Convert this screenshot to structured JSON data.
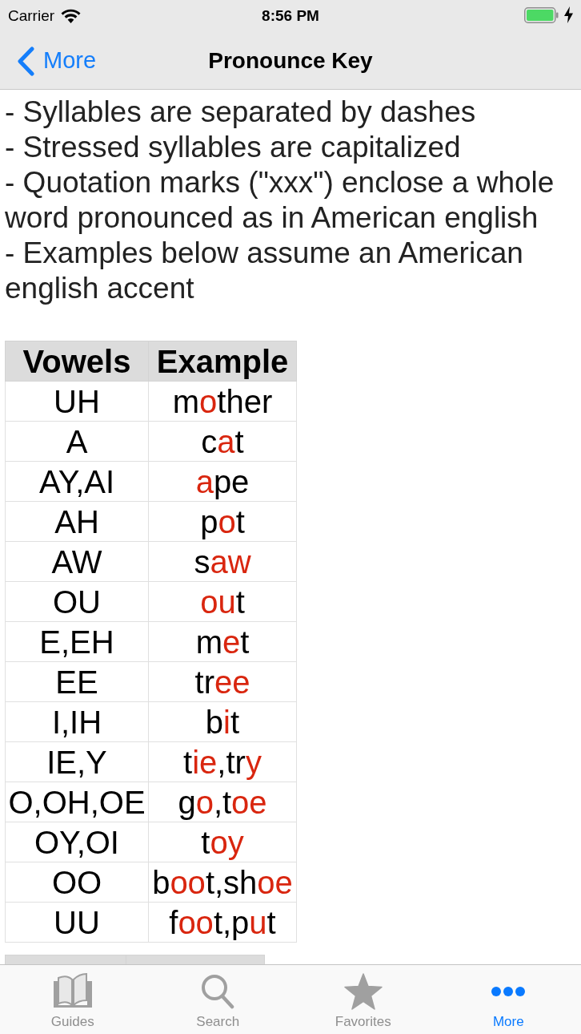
{
  "status_bar": {
    "carrier": "Carrier",
    "time": "8:56 PM"
  },
  "nav_bar": {
    "back": "More",
    "title": "Pronounce Key"
  },
  "notes": [
    "- Syllables are separated by dashes",
    "- Stressed syllables are capitalized",
    "- Quotation marks (\"xxx\") enclose a whole word pronounced as in American english",
    "- Examples below assume an American english accent"
  ],
  "vowel_table": {
    "columns": [
      "Vowels",
      "Example"
    ],
    "rows": [
      {
        "vowels": "UH",
        "example": [
          {
            "text": "m",
            "highlighted": false
          },
          {
            "text": "o",
            "highlighted": true
          },
          {
            "text": "ther",
            "highlighted": false
          }
        ]
      },
      {
        "vowels": "A",
        "example": [
          {
            "text": "c",
            "highlighted": false
          },
          {
            "text": "a",
            "highlighted": true
          },
          {
            "text": "t",
            "highlighted": false
          }
        ]
      },
      {
        "vowels": "AY,AI",
        "example": [
          {
            "text": "a",
            "highlighted": true
          },
          {
            "text": "pe",
            "highlighted": false
          }
        ]
      },
      {
        "vowels": "AH",
        "example": [
          {
            "text": "p",
            "highlighted": false
          },
          {
            "text": "o",
            "highlighted": true
          },
          {
            "text": "t",
            "highlighted": false
          }
        ]
      },
      {
        "vowels": "AW",
        "example": [
          {
            "text": "s",
            "highlighted": false
          },
          {
            "text": "aw",
            "highlighted": true
          }
        ]
      },
      {
        "vowels": "OU",
        "example": [
          {
            "text": "ou",
            "highlighted": true
          },
          {
            "text": "t",
            "highlighted": false
          }
        ]
      },
      {
        "vowels": "E,EH",
        "example": [
          {
            "text": "m",
            "highlighted": false
          },
          {
            "text": "e",
            "highlighted": true
          },
          {
            "text": "t",
            "highlighted": false
          }
        ]
      },
      {
        "vowels": "EE",
        "example": [
          {
            "text": "tr",
            "highlighted": false
          },
          {
            "text": "ee",
            "highlighted": true
          }
        ]
      },
      {
        "vowels": "I,IH",
        "example": [
          {
            "text": "b",
            "highlighted": false
          },
          {
            "text": "i",
            "highlighted": true
          },
          {
            "text": "t",
            "highlighted": false
          }
        ]
      },
      {
        "vowels": "IE,Y",
        "example": [
          {
            "text": "t",
            "highlighted": false
          },
          {
            "text": "ie",
            "highlighted": true
          },
          {
            "text": ",tr",
            "highlighted": false
          },
          {
            "text": "y",
            "highlighted": true
          }
        ]
      },
      {
        "vowels": "O,OH,OE",
        "example": [
          {
            "text": "g",
            "highlighted": false
          },
          {
            "text": "o",
            "highlighted": true
          },
          {
            "text": ",t",
            "highlighted": false
          },
          {
            "text": "oe",
            "highlighted": true
          }
        ]
      },
      {
        "vowels": "OY,OI",
        "example": [
          {
            "text": "t",
            "highlighted": false
          },
          {
            "text": "oy",
            "highlighted": true
          }
        ]
      },
      {
        "vowels": "OO",
        "example": [
          {
            "text": "b",
            "highlighted": false
          },
          {
            "text": "oo",
            "highlighted": true
          },
          {
            "text": "t,sh",
            "highlighted": false
          },
          {
            "text": "oe",
            "highlighted": true
          }
        ]
      },
      {
        "vowels": "UU",
        "example": [
          {
            "text": "f",
            "highlighted": false
          },
          {
            "text": "oo",
            "highlighted": true
          },
          {
            "text": "t,p",
            "highlighted": false
          },
          {
            "text": "u",
            "highlighted": true
          },
          {
            "text": "t",
            "highlighted": false
          }
        ]
      }
    ]
  },
  "tab_bar": [
    {
      "label": "Guides",
      "selected": false
    },
    {
      "label": "Search",
      "selected": false
    },
    {
      "label": "Favorites",
      "selected": false
    },
    {
      "label": "More",
      "selected": true
    }
  ]
}
